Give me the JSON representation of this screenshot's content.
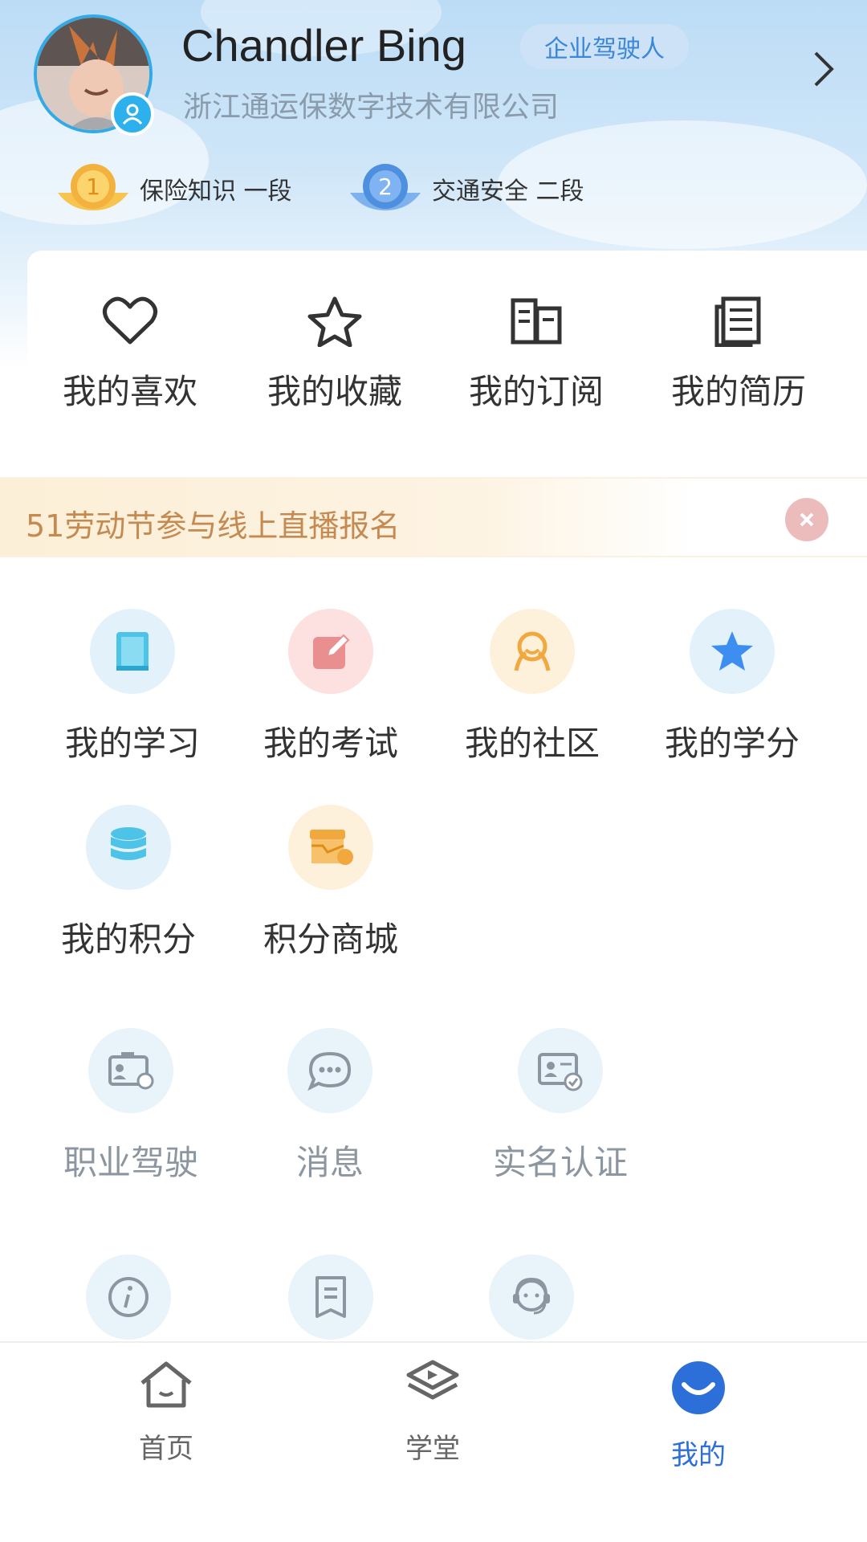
{
  "header": {
    "user_name": "Chandler Bing",
    "role_badge": "企业驾驶人",
    "company": "浙江通运保数字技术有限公司",
    "ranks": [
      {
        "label": "保险知识 一段",
        "medal": "1",
        "color": "#f3b23e"
      },
      {
        "label": "交通安全 二段",
        "medal": "2",
        "color": "#4f8fe0"
      }
    ]
  },
  "quick": [
    {
      "label": "我的喜欢",
      "icon": "heart-icon"
    },
    {
      "label": "我的收藏",
      "icon": "star-icon"
    },
    {
      "label": "我的订阅",
      "icon": "subscribe-icon"
    },
    {
      "label": "我的简历",
      "icon": "resume-icon"
    }
  ],
  "banner": {
    "text": "51劳动节参与线上直播报名"
  },
  "grid1": [
    {
      "label": "我的学习",
      "icon": "book-icon",
      "bg": "#e3f1fb"
    },
    {
      "label": "我的考试",
      "icon": "exam-edit-icon",
      "bg": "#fde0e0"
    },
    {
      "label": "我的社区",
      "icon": "community-icon",
      "bg": "#fdf1dc"
    },
    {
      "label": "我的学分",
      "icon": "credit-star-icon",
      "bg": "#e3f1fb"
    },
    {
      "label": "我的积分",
      "icon": "points-database-icon",
      "bg": "#e3f1fb"
    },
    {
      "label": "积分商城",
      "icon": "mall-box-icon",
      "bg": "#fdf1dc"
    }
  ],
  "grid2": [
    {
      "label": "职业驾驶",
      "icon": "driver-license-icon"
    },
    {
      "label": "消息",
      "icon": "message-icon"
    },
    {
      "label": "实名认证",
      "icon": "id-verify-icon"
    }
  ],
  "grid3": [
    {
      "icon": "info-icon"
    },
    {
      "icon": "document-icon"
    },
    {
      "icon": "customer-service-icon"
    }
  ],
  "tabs": [
    {
      "label": "首页",
      "icon": "home-icon"
    },
    {
      "label": "学堂",
      "icon": "classroom-icon"
    },
    {
      "label": "我的",
      "icon": "profile-smile-icon"
    }
  ],
  "colors": {
    "accent": "#2c6fd8",
    "header_bg": "#cfe6f8",
    "banner_text": "#c58a52"
  }
}
